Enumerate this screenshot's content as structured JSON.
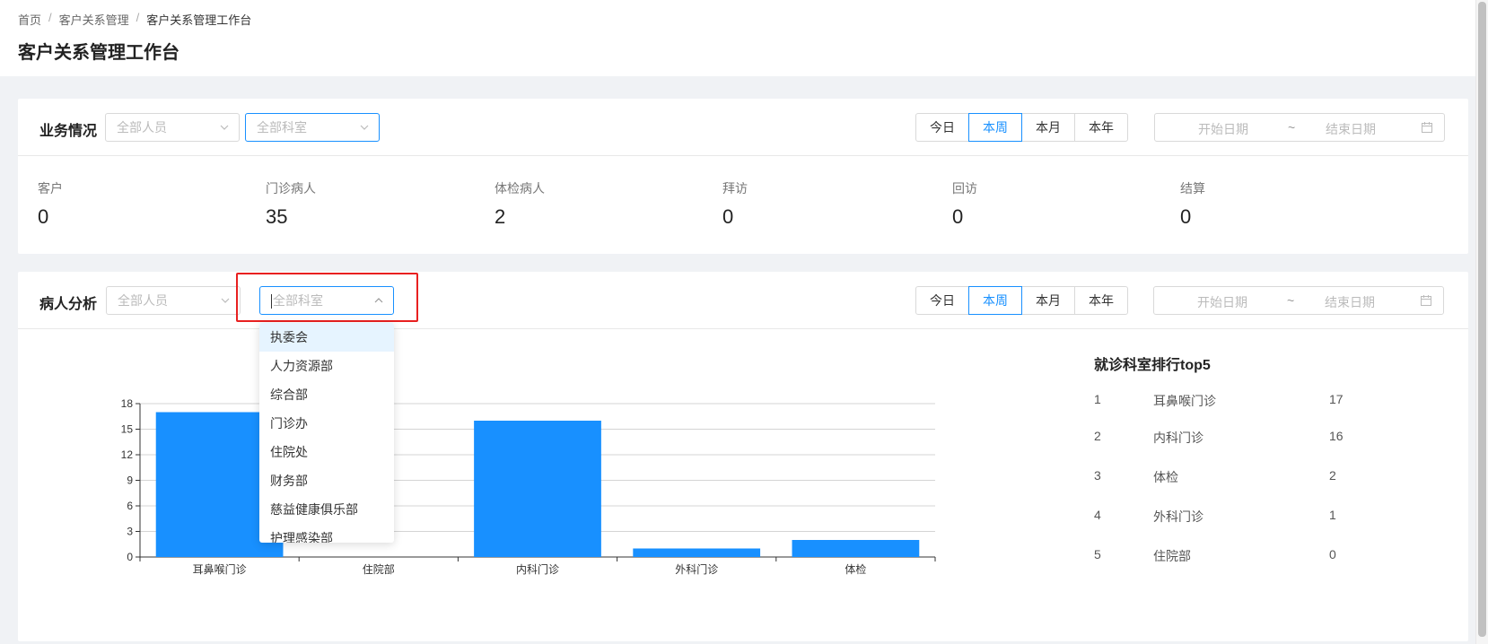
{
  "breadcrumb": [
    "首页",
    "客户关系管理",
    "客户关系管理工作台"
  ],
  "page_title": "客户关系管理工作台",
  "business": {
    "title": "业务情况",
    "person_placeholder": "全部人员",
    "dept_placeholder": "全部科室",
    "periods": [
      "今日",
      "本周",
      "本月",
      "本年"
    ],
    "active_period": "本周",
    "date_start": "开始日期",
    "date_sep": "~",
    "date_end": "结束日期",
    "stats": [
      {
        "label": "客户",
        "value": "0"
      },
      {
        "label": "门诊病人",
        "value": "35"
      },
      {
        "label": "体检病人",
        "value": "2"
      },
      {
        "label": "拜访",
        "value": "0"
      },
      {
        "label": "回访",
        "value": "0"
      },
      {
        "label": "结算",
        "value": "0"
      }
    ]
  },
  "patient": {
    "title": "病人分析",
    "person_placeholder": "全部人员",
    "dept_placeholder": "全部科室",
    "periods": [
      "今日",
      "本周",
      "本月",
      "本年"
    ],
    "active_period": "本周",
    "date_start": "开始日期",
    "date_sep": "~",
    "date_end": "结束日期",
    "dept_options": [
      "执委会",
      "人力资源部",
      "综合部",
      "门诊办",
      "住院处",
      "财务部",
      "慈益健康俱乐部",
      "护理感染部"
    ],
    "hovered_option": "执委会",
    "ranking": {
      "title": "就诊科室排行top5",
      "rows": [
        {
          "idx": "1",
          "name": "耳鼻喉门诊",
          "count": "17"
        },
        {
          "idx": "2",
          "name": "内科门诊",
          "count": "16"
        },
        {
          "idx": "3",
          "name": "体检",
          "count": "2"
        },
        {
          "idx": "4",
          "name": "外科门诊",
          "count": "1"
        },
        {
          "idx": "5",
          "name": "住院部",
          "count": "0"
        }
      ]
    }
  },
  "chart_data": {
    "type": "bar",
    "categories": [
      "耳鼻喉门诊",
      "住院部",
      "内科门诊",
      "外科门诊",
      "体检"
    ],
    "values": [
      17,
      0,
      16,
      1,
      2
    ],
    "ylim": [
      0,
      18
    ],
    "yticks": [
      0,
      3,
      6,
      9,
      12,
      15,
      18
    ],
    "title": "",
    "xlabel": "",
    "ylabel": "",
    "grid": true,
    "bar_color": "#1890ff"
  },
  "colors": {
    "accent": "#1890ff",
    "highlight": "#e82020"
  }
}
